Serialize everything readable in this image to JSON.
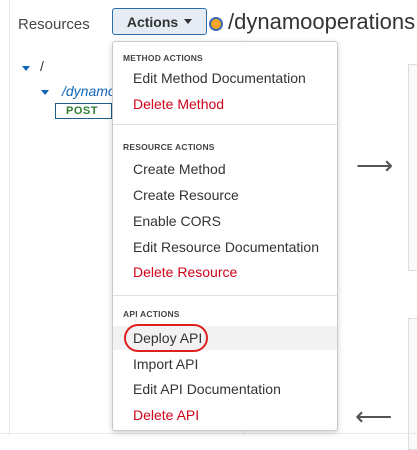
{
  "sidebar": {
    "title": "Resources",
    "tree": {
      "root_label": "/",
      "resource_label": "/dynamo",
      "method_badge": "POST"
    }
  },
  "header": {
    "actions_label": "Actions",
    "path_title": "/dynamooperations"
  },
  "menu": {
    "method_actions_header": "METHOD ACTIONS",
    "method_items": [
      {
        "label": "Edit Method Documentation",
        "danger": false
      },
      {
        "label": "Delete Method",
        "danger": true
      }
    ],
    "resource_actions_header": "RESOURCE ACTIONS",
    "resource_items": [
      {
        "label": "Create Method",
        "danger": false
      },
      {
        "label": "Create Resource",
        "danger": false
      },
      {
        "label": "Enable CORS",
        "danger": false
      },
      {
        "label": "Edit Resource Documentation",
        "danger": false
      },
      {
        "label": "Delete Resource",
        "danger": true
      }
    ],
    "api_actions_header": "API ACTIONS",
    "api_items": [
      {
        "label": "Deploy API",
        "danger": false,
        "highlighted": true
      },
      {
        "label": "Import API",
        "danger": false
      },
      {
        "label": "Edit API Documentation",
        "danger": false
      },
      {
        "label": "Delete API",
        "danger": true
      }
    ]
  },
  "icons": {
    "actions_caret": "chevron-down-icon",
    "tree_caret": "caret-down-icon",
    "flow_right": "arrow-right-icon",
    "flow_left": "arrow-left-icon",
    "resource_status": "resource-dot-icon"
  },
  "colors": {
    "accent": "#1166bb",
    "danger": "#d0021b",
    "post_badge_text": "#2e7d32",
    "annotation": "#e01f1f"
  }
}
